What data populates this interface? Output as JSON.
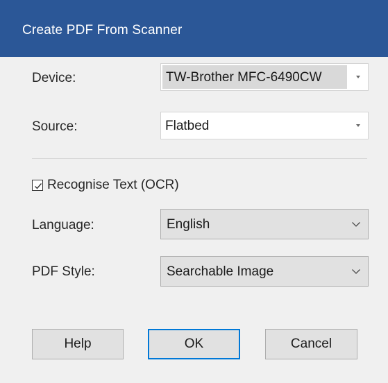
{
  "dialog": {
    "title": "Create PDF From Scanner"
  },
  "device": {
    "label": "Device:",
    "value": "TW-Brother MFC-6490CW",
    "icon": "chevron-down-icon"
  },
  "source": {
    "label": "Source:",
    "value": "Flatbed",
    "icon": "chevron-down-icon"
  },
  "ocr": {
    "label": "Recognise Text (OCR)",
    "checked": true
  },
  "language": {
    "label": "Language:",
    "value": "English",
    "icon": "chevron-down-icon"
  },
  "pdf_style": {
    "label": "PDF Style:",
    "value": "Searchable Image",
    "icon": "chevron-down-icon"
  },
  "buttons": {
    "help": "Help",
    "ok": "OK",
    "cancel": "Cancel"
  },
  "colors": {
    "titlebar": "#2b5797",
    "dialog_body": "#f0f0f0",
    "default_button_border": "#0078d7"
  }
}
